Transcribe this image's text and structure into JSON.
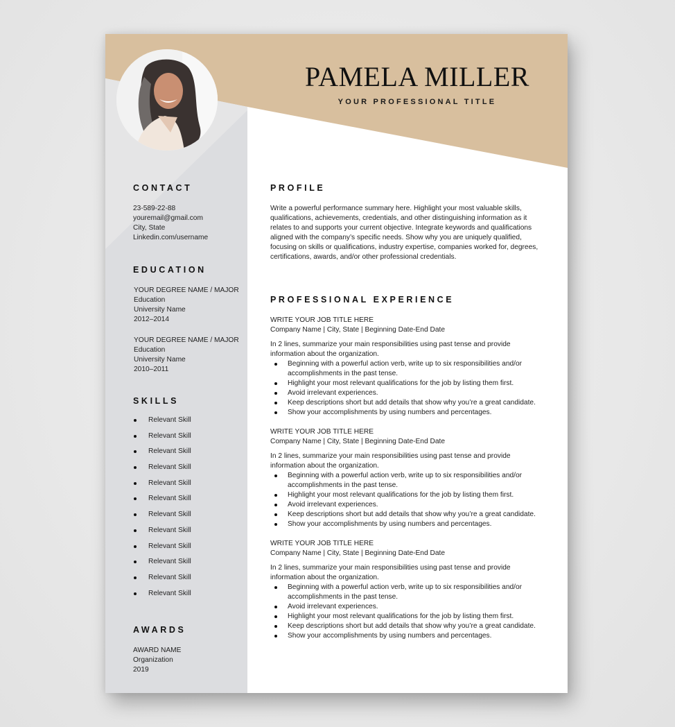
{
  "header": {
    "name": "PAMELA MILLER",
    "title": "YOUR PROFESSIONAL TITLE",
    "photo_alt": "Profile photo of a smiling woman with long dark hair"
  },
  "colors": {
    "accent_tan": "#d8bf9e",
    "sidebar_gray": "#dcdde0",
    "sidebar_light": "#e4e4e6",
    "page_bg": "#ffffff"
  },
  "sidebar": {
    "contact": {
      "heading": "CONTACT",
      "phone": "23-589-22-88",
      "email": "youremail@gmail.com",
      "location": "City, State",
      "linkedin": "Linkedin.com/username"
    },
    "education": {
      "heading": "EDUCATION",
      "items": [
        {
          "degree": "YOUR DEGREE NAME / MAJOR",
          "field": "Education",
          "school": "University Name",
          "years": "2012–2014"
        },
        {
          "degree": "YOUR DEGREE NAME / MAJOR",
          "field": "Education",
          "school": "University Name",
          "years": "2010–2011"
        }
      ]
    },
    "skills": {
      "heading": "SKILLS",
      "items": [
        "Relevant Skill",
        "Relevant Skill",
        "Relevant Skill",
        "Relevant Skill",
        "Relevant Skill",
        "Relevant Skill",
        "Relevant Skill",
        "Relevant Skill",
        "Relevant Skill",
        "Relevant Skill",
        "Relevant Skill",
        "Relevant Skill"
      ]
    },
    "awards": {
      "heading": "AWARDS",
      "name": "AWARD NAME",
      "organization": "Organization",
      "year": "2019"
    }
  },
  "main": {
    "profile": {
      "heading": "PROFILE",
      "text": "Write a powerful performance summary here. Highlight your most valuable skills, qualifications, achievements, credentials, and other distinguishing information as it relates to and supports your current objective. Integrate keywords and qualifications aligned with the company’s specific needs. Show why you are uniquely qualified, focusing on skills or qualifications, industry expertise, companies worked for, degrees, certifications, awards, and/or other professional credentials."
    },
    "experience": {
      "heading": "PROFESSIONAL EXPERIENCE",
      "jobs": [
        {
          "title": "WRITE YOUR JOB TITLE HERE",
          "meta": "Company Name | City, State | Beginning Date-End Date",
          "summary": "In 2 lines, summarize your main responsibilities using past tense and provide information about the organization.",
          "bullets": [
            "Beginning with a powerful action verb, write up to six responsibilities and/or accomplishments in the past tense.",
            "Highlight your most relevant qualifications for the job by listing them first.",
            "Avoid irrelevant experiences.",
            "Keep descriptions short but add details that show why you’re a great candidate.",
            "Show your accomplishments by using numbers and percentages."
          ]
        },
        {
          "title": "WRITE YOUR JOB TITLE HERE",
          "meta": "Company Name | City, State | Beginning Date-End Date",
          "summary": "In 2 lines, summarize your main responsibilities using past tense and provide information about the organization.",
          "bullets": [
            "Beginning with a powerful action verb, write up to six responsibilities and/or accomplishments in the past tense.",
            "Highlight your most relevant qualifications for the job by listing them first.",
            "Avoid irrelevant experiences.",
            "Keep descriptions short but add details that show why you’re a great candidate.",
            "Show your accomplishments by using numbers and percentages."
          ]
        },
        {
          "title": "WRITE YOUR JOB TITLE HERE",
          "meta": "Company Name | City, State | Beginning Date-End Date",
          "summary": "In 2 lines, summarize your main responsibilities using past tense and provide information about the organization.",
          "bullets": [
            "Beginning with a powerful action verb, write up to six responsibilities and/or accomplishments in the past tense.",
            "Avoid irrelevant experiences.",
            "Highlight your most relevant qualifications for the job by listing them first.",
            "Keep descriptions short but add details that show why you’re a great candidate.",
            "Show your accomplishments by using numbers and percentages."
          ]
        }
      ]
    }
  }
}
